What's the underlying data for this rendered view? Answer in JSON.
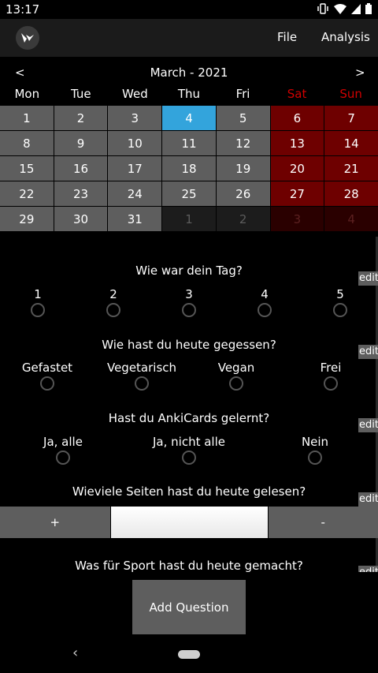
{
  "status": {
    "time": "13:17"
  },
  "appbar": {
    "file": "File",
    "analysis": "Analysis",
    "logo_icon": "kivy-logo-icon"
  },
  "calendar": {
    "prev": "<",
    "next": ">",
    "title": "March - 2021",
    "weekdays": [
      "Mon",
      "Tue",
      "Wed",
      "Thu",
      "Fri",
      "Sat",
      "Sun"
    ],
    "days": [
      [
        "1",
        "2",
        "3",
        "4",
        "5",
        "6",
        "7"
      ],
      [
        "8",
        "9",
        "10",
        "11",
        "12",
        "13",
        "14"
      ],
      [
        "15",
        "16",
        "17",
        "18",
        "19",
        "20",
        "21"
      ],
      [
        "22",
        "23",
        "24",
        "25",
        "26",
        "27",
        "28"
      ],
      [
        "29",
        "30",
        "31",
        "1",
        "2",
        "3",
        "4"
      ]
    ],
    "today": "4",
    "colors": {
      "day": "#5e5e5e",
      "today": "#33a4dc",
      "weekend": "#6e0000",
      "other": "#1c1c1c",
      "weekend_label": "#d00000"
    }
  },
  "edit_label": "edit",
  "q1": {
    "text": "Wie war dein Tag?",
    "options": [
      "1",
      "2",
      "3",
      "4",
      "5"
    ]
  },
  "q2": {
    "text": "Wie hast du heute gegessen?",
    "options": [
      "Gefastet",
      "Vegetarisch",
      "Vegan",
      "Frei"
    ]
  },
  "q3": {
    "text": "Hast du AnkiCards gelernt?",
    "options": [
      "Ja, alle",
      "Ja, nicht alle",
      "Nein"
    ]
  },
  "q4": {
    "text": "Wieviele Seiten hast du heute gelesen?",
    "plus": "+",
    "minus": "-",
    "value": ""
  },
  "q5": {
    "text": "Was für Sport hast du heute gemacht?"
  },
  "add_question": "Add Question",
  "nav": {
    "back": "‹"
  }
}
